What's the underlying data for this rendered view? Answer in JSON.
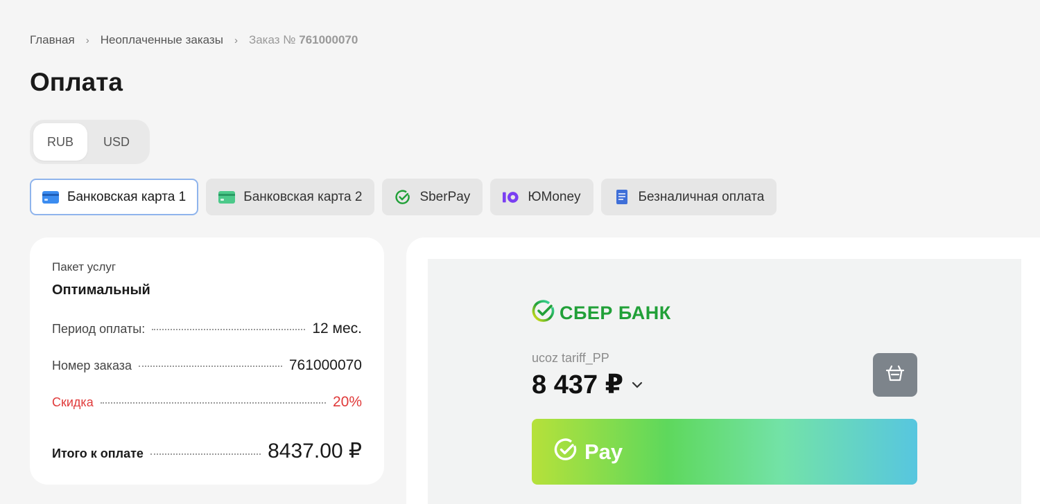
{
  "breadcrumb": {
    "home": "Главная",
    "unpaid": "Неоплаченные заказы",
    "current_prefix": "Заказ №",
    "current_number": "761000070"
  },
  "page_title": "Оплата",
  "currency": {
    "options": [
      "RUB",
      "USD"
    ],
    "selected": "RUB"
  },
  "payment_methods": [
    {
      "label": "Банковская карта 1",
      "icon": "bank-card-icon",
      "active": true
    },
    {
      "label": "Банковская карта 2",
      "icon": "bank-card-icon",
      "active": false
    },
    {
      "label": "SberPay",
      "icon": "sberpay-icon",
      "active": false
    },
    {
      "label": "ЮMoney",
      "icon": "yoomoney-icon",
      "active": false
    },
    {
      "label": "Безналичная оплата",
      "icon": "invoice-icon",
      "active": false
    }
  ],
  "order": {
    "package_label": "Пакет услуг",
    "package_name": "Оптимальный",
    "period_label": "Период оплаты:",
    "period_value": "12 мес.",
    "number_label": "Номер заказа",
    "number_value": "761000070",
    "discount_label": "Скидка",
    "discount_value": "20%",
    "total_label": "Итого к оплате",
    "total_value": "8437.00 ₽"
  },
  "sber": {
    "logo_text": "СБЕР БАНК",
    "merchant": "ucoz tariff_PP",
    "amount": "8 437 ₽",
    "pay_label": "Pay"
  },
  "colors": {
    "accent_border": "#8fb4ec",
    "discount": "#e03a3a",
    "sber_green": "#21a038"
  }
}
